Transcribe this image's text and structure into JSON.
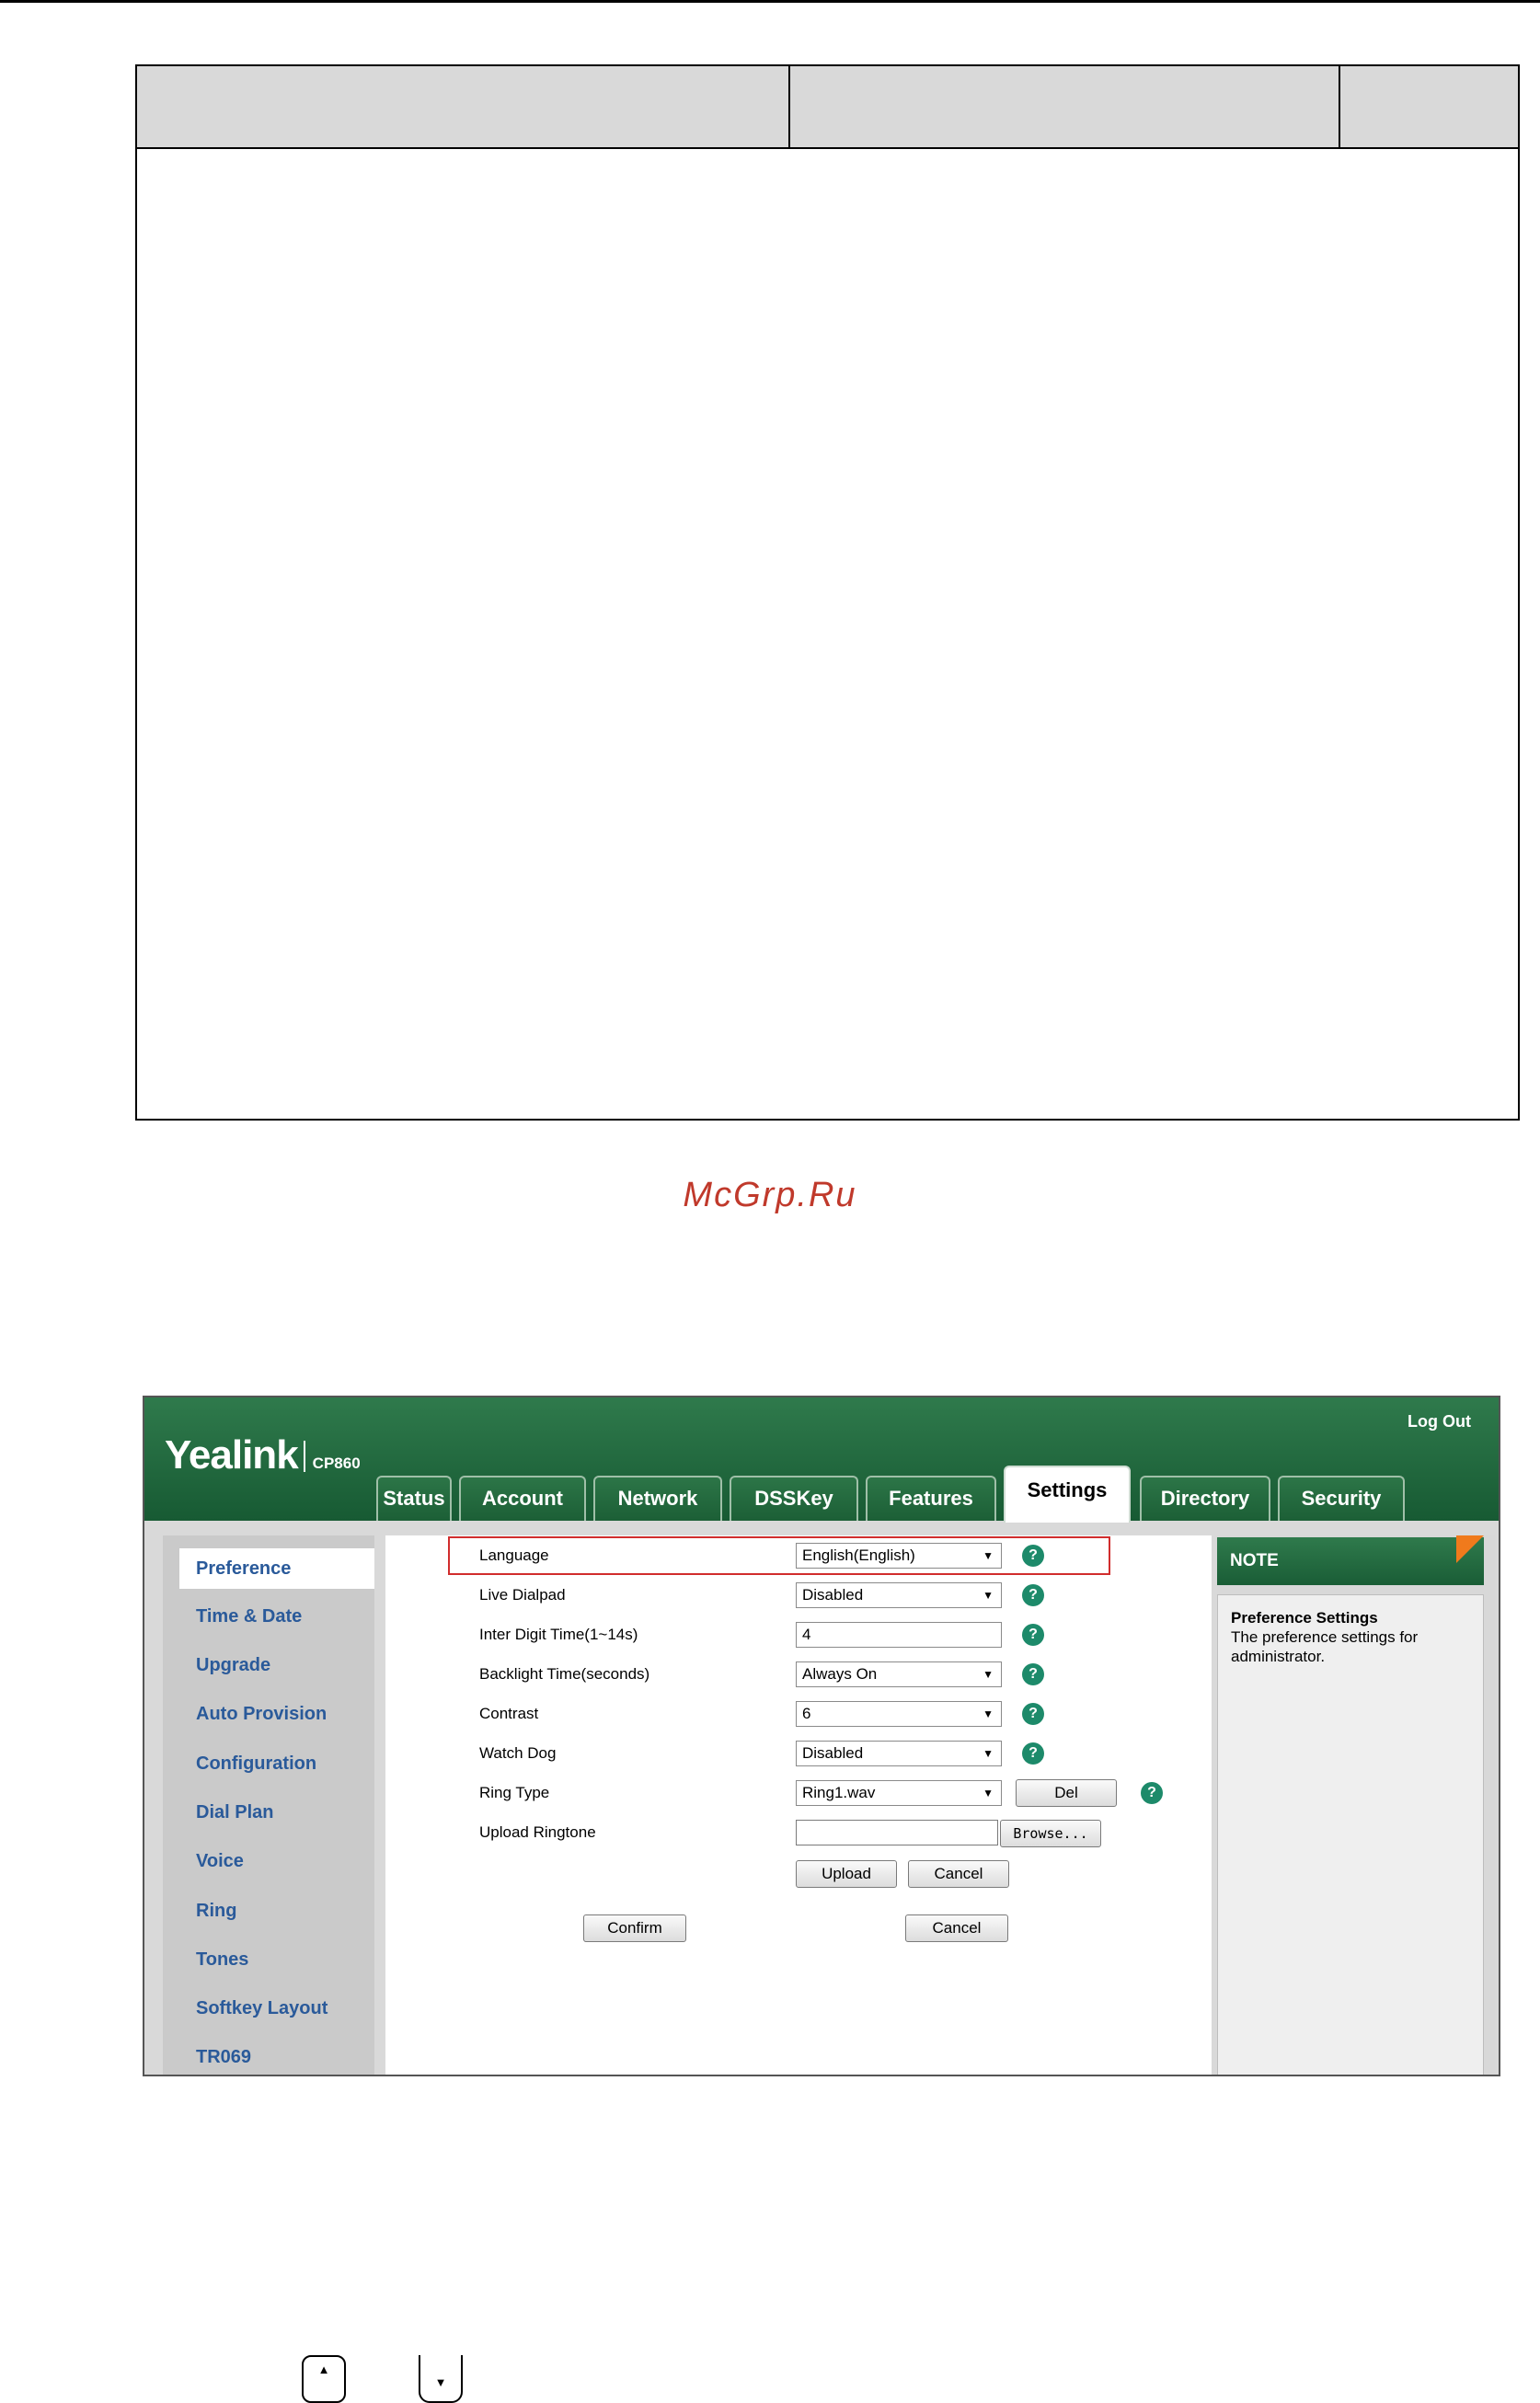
{
  "watermark": "McGrp.Ru",
  "shot": {
    "logout": "Log Out",
    "brand": "Yealink",
    "model": "CP860",
    "tabs": [
      "Status",
      "Account",
      "Network",
      "DSSKey",
      "Features",
      "Settings",
      "Directory",
      "Security"
    ],
    "active_tab": "Settings",
    "sidebar": [
      "Preference",
      "Time & Date",
      "Upgrade",
      "Auto Provision",
      "Configuration",
      "Dial Plan",
      "Voice",
      "Ring",
      "Tones",
      "Softkey Layout",
      "TR069"
    ],
    "active_sidebar": "Preference",
    "fields": {
      "language": {
        "label": "Language",
        "value": "English(English)"
      },
      "live_dialpad": {
        "label": "Live Dialpad",
        "value": "Disabled"
      },
      "inter_digit": {
        "label": "Inter Digit Time(1~14s)",
        "value": "4"
      },
      "backlight": {
        "label": "Backlight Time(seconds)",
        "value": "Always On"
      },
      "contrast": {
        "label": "Contrast",
        "value": "6"
      },
      "watch_dog": {
        "label": "Watch Dog",
        "value": "Disabled"
      },
      "ring_type": {
        "label": "Ring Type",
        "value": "Ring1.wav"
      },
      "upload_ringtone": {
        "label": "Upload Ringtone",
        "value": ""
      }
    },
    "buttons": {
      "del": "Del",
      "browse": "Browse...",
      "upload": "Upload",
      "cancel_upload": "Cancel",
      "confirm": "Confirm",
      "cancel": "Cancel"
    },
    "help_glyph": "?",
    "arrow_glyph": "▼",
    "note": {
      "head": "NOTE",
      "title": "Preference Settings",
      "text": "The preference settings for administrator."
    }
  },
  "keys": {
    "up": "▲",
    "down": "▼"
  },
  "icons": [
    "help-icon",
    "dropdown-arrow-icon",
    "up-key-icon",
    "down-key-icon"
  ]
}
